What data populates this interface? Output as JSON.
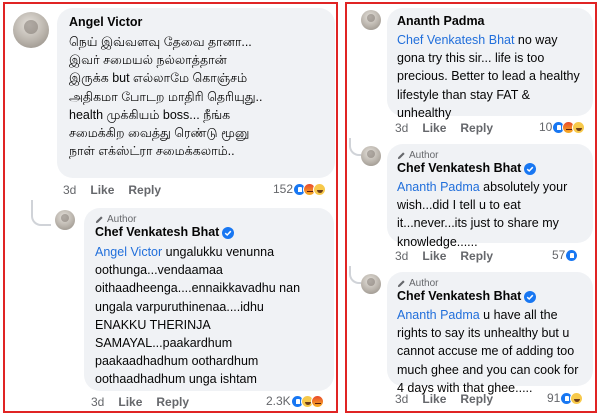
{
  "left": {
    "comment1": {
      "author": "Angel Victor",
      "lines": [
        "நெய் இவ்வளவு தேவை தானா...",
        "இவர் சமையல் நல்லாத்தான்",
        "இருக்க but எல்லாமே கொஞ்சம்",
        "அதிகமா போடற மாதிரி தெரியுது..",
        "health முக்கியம் boss... நீங்க",
        "சமைக்கிற வைத்து ரெண்டு மூனு",
        "நாள் எக்ஸ்ட்ரா சமைக்கலாம்.."
      ],
      "time": "3d",
      "like": "Like",
      "reply": "Reply",
      "reactions_count": "152",
      "reactions": [
        "like-emoji-icon",
        "angry-emoji-icon",
        "haha-emoji-icon"
      ]
    },
    "reply1": {
      "author_badge": "Author",
      "author": "Chef Venkatesh Bhat",
      "mention": "Angel Victor",
      "first_rest": " ungalukku venunna",
      "lines": [
        "oothunga...vendaamaa",
        "oithaadheenga....ennaikkavadhu nan",
        "ungala varpuruthinenaa....idhu",
        "ENAKKU THERINJA",
        "SAMAYAL...paakardhum",
        "paakaadhadhum   oothardhum",
        "oothaadhadhum unga ishtam"
      ],
      "time": "3d",
      "like": "Like",
      "reply": "Reply",
      "reactions_count": "2.3K",
      "reactions": [
        "like-emoji-icon",
        "haha-emoji-icon",
        "angry-emoji-icon"
      ]
    }
  },
  "right": {
    "comment1": {
      "author": "Ananth Padma",
      "mention": "Chef Venkatesh Bhat",
      "first_rest": " no way",
      "lines": [
        "gona try this sir... life is too",
        "precious. Better to lead a healthy",
        "lifestyle than stay FAT &",
        "unhealthy"
      ],
      "time": "3d",
      "like": "Like",
      "reply": "Reply",
      "reactions_count": "10",
      "reactions": [
        "like-emoji-icon",
        "angry-emoji-icon",
        "haha-emoji-icon"
      ]
    },
    "reply1": {
      "author_badge": "Author",
      "author": "Chef Venkatesh Bhat",
      "mention": "Ananth Padma",
      "first_rest": " absolutely your",
      "lines": [
        "wish...did I tell u to eat",
        "it...never...its just to share my",
        "knowledge......"
      ],
      "time": "3d",
      "like": "Like",
      "reply": "Reply",
      "reactions_count": "57",
      "reactions": [
        "like-emoji-icon"
      ]
    },
    "reply2": {
      "author_badge": "Author",
      "author": "Chef Venkatesh Bhat",
      "mention": "Ananth Padma",
      "first_rest": " u have all the",
      "lines": [
        "rights to say its unhealthy but u",
        "cannot accuse me of adding too",
        "much ghee and you can cook for",
        "4 days with that ghee....."
      ],
      "time": "3d",
      "like": "Like",
      "reply": "Reply",
      "reactions_count": "91",
      "reactions": [
        "like-emoji-icon",
        "haha-emoji-icon"
      ]
    }
  },
  "colors": {
    "border": "#e02424",
    "bubble": "#f0f2f5",
    "mention": "#216fdb",
    "verified": "#1877f2"
  }
}
